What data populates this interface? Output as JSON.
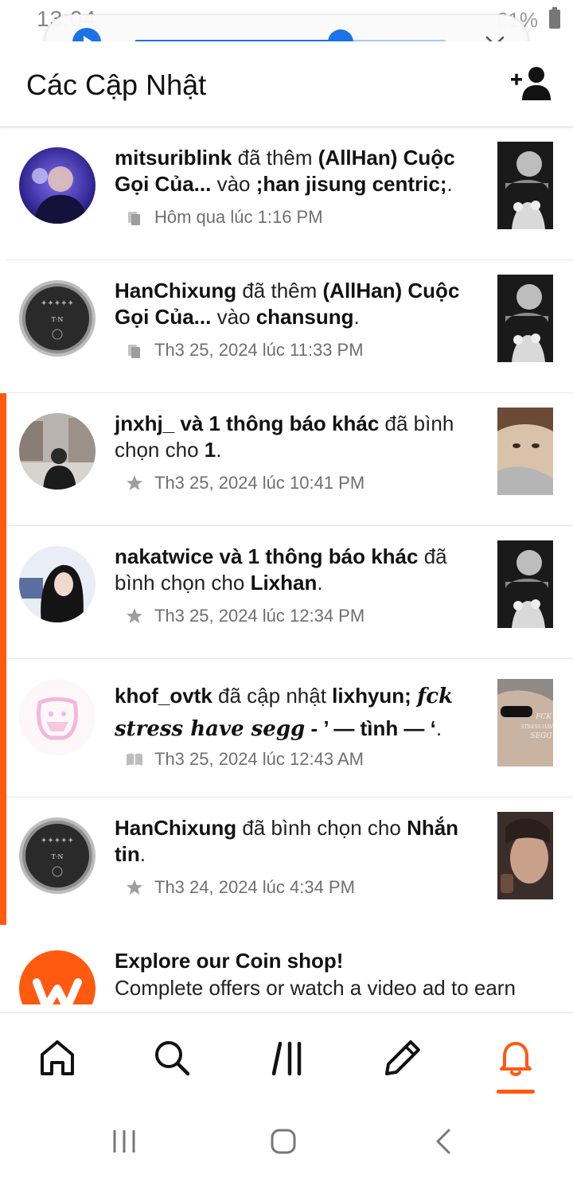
{
  "status_bar": {
    "time": "13:04",
    "battery": "61%"
  },
  "media_player": {
    "progress": 0.66
  },
  "header": {
    "title": "Các Cập Nhật"
  },
  "notifications": [
    {
      "actor": "mitsuriblink",
      "verb": " đã thêm ",
      "object": "(AllHan) Cuộc Gọi Của...",
      "connector": " vào ",
      "target": ";han jisung centric;",
      "end": ".",
      "time": "Hôm qua lúc 1:16 PM",
      "meta_icon": "reading-list-icon",
      "unread": false
    },
    {
      "actor": "HanChixung",
      "verb": " đã thêm ",
      "object": "(AllHan) Cuộc Gọi Của...",
      "connector": " vào ",
      "target": "chansung",
      "end": ".",
      "time": "Th3 25, 2024 lúc 11:33 PM",
      "meta_icon": "reading-list-icon",
      "unread": false
    },
    {
      "actor": "jnxhj_ và 1 thông báo khác",
      "verb": " đã bình chọn cho ",
      "target": "1",
      "end": ".",
      "time": "Th3 25, 2024 lúc 10:41 PM",
      "meta_icon": "star-icon",
      "unread": true
    },
    {
      "actor": "nakatwice và 1 thông báo khác",
      "verb": " đã bình chọn cho ",
      "target": "Lixhan",
      "end": ".",
      "time": "Th3 25, 2024 lúc 12:34 PM",
      "meta_icon": "star-icon",
      "unread": true
    },
    {
      "actor": "khof_ovtk",
      "verb": " đã cập nhật ",
      "target": "lixhyun; ",
      "script_text": "fck stress have segg",
      "tail": " - ’ — tình — ‘",
      "end": ".",
      "time": "Th3 25, 2024 lúc 12:43 AM",
      "meta_icon": "book-icon",
      "unread": true
    },
    {
      "actor": "HanChixung",
      "verb": " đã bình chọn cho ",
      "target": "Nhắn tin",
      "end": ".",
      "time": "Th3 24, 2024 lúc 4:34 PM",
      "meta_icon": "star-icon",
      "unread": true
    }
  ],
  "promo": {
    "title": "Explore our Coin shop!",
    "body": "Complete offers or watch a video ad to earn"
  },
  "bottom_nav": [
    {
      "name": "home",
      "icon": "home-icon"
    },
    {
      "name": "search",
      "icon": "search-icon"
    },
    {
      "name": "library",
      "icon": "library-icon"
    },
    {
      "name": "write",
      "icon": "pencil-icon"
    },
    {
      "name": "notifications",
      "icon": "bell-icon",
      "active": true
    }
  ],
  "colors": {
    "accent": "#ff5a10",
    "media_blue": "#1a73e8",
    "meta_grey": "#6f6f6f"
  }
}
